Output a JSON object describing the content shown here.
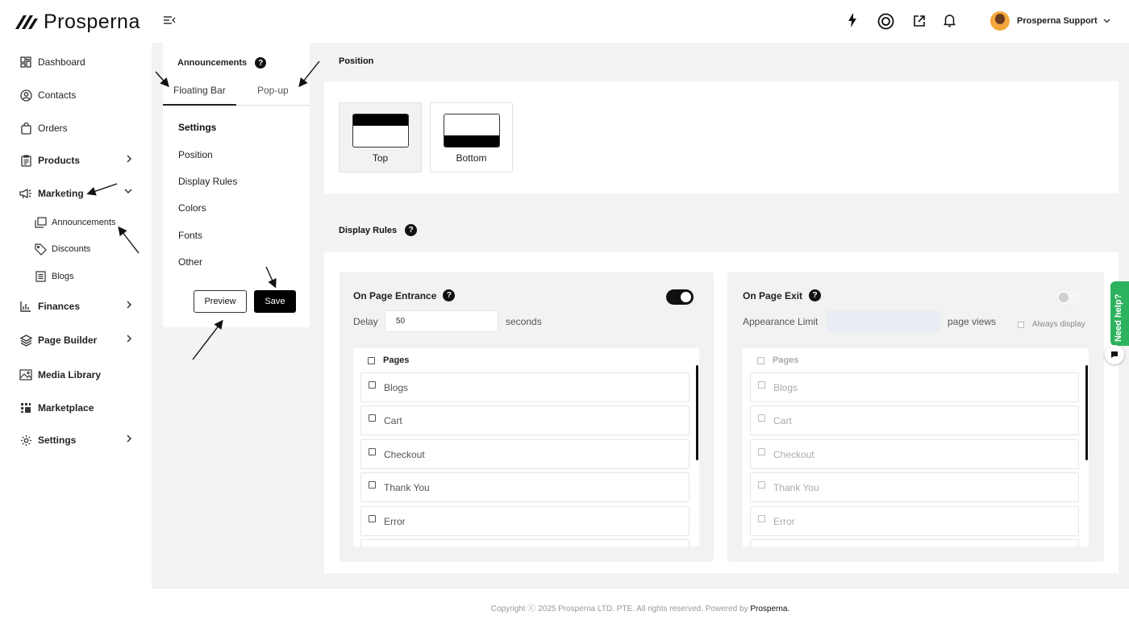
{
  "brand": {
    "name": "Prosperna"
  },
  "sidebar": {
    "items": [
      {
        "label": "Dashboard"
      },
      {
        "label": "Contacts"
      },
      {
        "label": "Orders"
      },
      {
        "label": "Products"
      },
      {
        "label": "Marketing"
      },
      {
        "label": "Finances"
      },
      {
        "label": "Page Builder"
      },
      {
        "label": "Media Library"
      },
      {
        "label": "Marketplace"
      },
      {
        "label": "Settings"
      }
    ],
    "marketing_sub": [
      {
        "label": "Announcements"
      },
      {
        "label": "Discounts"
      },
      {
        "label": "Blogs"
      }
    ]
  },
  "header": {
    "user_name": "Prosperna Support"
  },
  "panel": {
    "title": "Announcements",
    "tabs": [
      {
        "label": "Floating Bar"
      },
      {
        "label": "Pop-up"
      }
    ],
    "settings_heading": "Settings",
    "settings_links": [
      {
        "label": "Position"
      },
      {
        "label": "Display Rules"
      },
      {
        "label": "Colors"
      },
      {
        "label": "Fonts"
      },
      {
        "label": "Other"
      }
    ],
    "preview_label": "Preview",
    "save_label": "Save"
  },
  "position": {
    "label": "Position",
    "options": [
      {
        "label": "Top",
        "selected": true
      },
      {
        "label": "Bottom",
        "selected": false
      }
    ]
  },
  "display_rules": {
    "label": "Display Rules",
    "entrance": {
      "title": "On Page Entrance",
      "toggle_on": true,
      "delay_label": "Delay",
      "delay_value": "50",
      "delay_unit": "seconds",
      "pages_header": "Pages",
      "pages": [
        "Blogs",
        "Cart",
        "Checkout",
        "Thank You",
        "Error"
      ]
    },
    "exit": {
      "title": "On Page Exit",
      "toggle_on": false,
      "limit_label": "Appearance Limit",
      "limit_value": "",
      "limit_unit": "page views",
      "always_display_label": "Always display",
      "pages_header": "Pages",
      "pages": [
        "Blogs",
        "Cart",
        "Checkout",
        "Thank You",
        "Error"
      ]
    }
  },
  "footer": {
    "text": "Copyright ⓒ 2025 Prosperna LTD. PTE. All rights reserved. Powered by",
    "link": "Prosperna."
  },
  "help_widget": {
    "label": "Need help?"
  }
}
